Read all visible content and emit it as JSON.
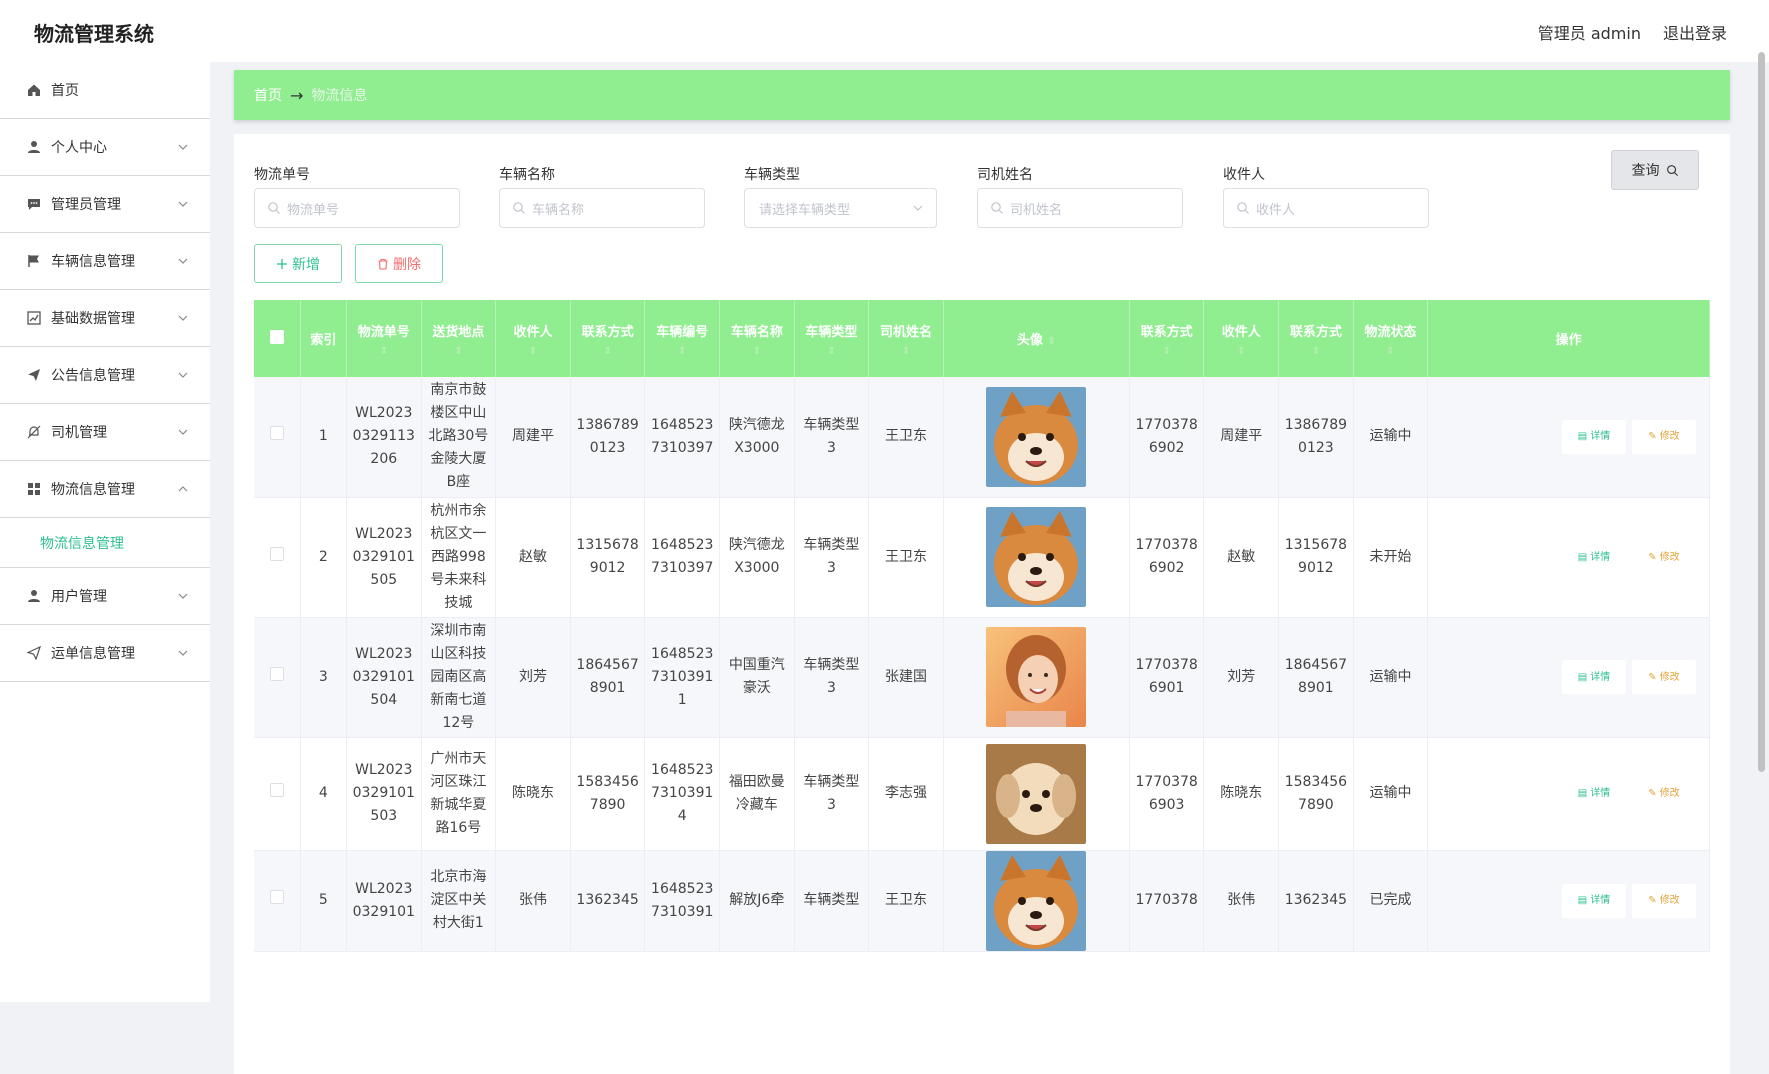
{
  "app": {
    "title": "物流管理系统",
    "user_label": "管理员 admin",
    "logout_label": "退出登录"
  },
  "sidebar": {
    "items": [
      {
        "label": "首页",
        "icon": "home-icon"
      },
      {
        "label": "个人中心",
        "icon": "user-icon"
      },
      {
        "label": "管理员管理",
        "icon": "chat-icon"
      },
      {
        "label": "车辆信息管理",
        "icon": "flag-icon"
      },
      {
        "label": "基础数据管理",
        "icon": "chart-icon"
      },
      {
        "label": "公告信息管理",
        "icon": "send-icon"
      },
      {
        "label": "司机管理",
        "icon": "bell-off-icon"
      },
      {
        "label": "物流信息管理",
        "icon": "grid-icon"
      },
      {
        "label": "用户管理",
        "icon": "user-icon"
      },
      {
        "label": "运单信息管理",
        "icon": "send-icon"
      }
    ],
    "submenu_label": "物流信息管理"
  },
  "breadcrumb": {
    "home": "首页",
    "arrow": "→",
    "current": "物流信息"
  },
  "filters": {
    "order_no": {
      "label": "物流单号",
      "placeholder": "物流单号"
    },
    "vehicle_name": {
      "label": "车辆名称",
      "placeholder": "车辆名称"
    },
    "vehicle_type": {
      "label": "车辆类型",
      "placeholder": "请选择车辆类型"
    },
    "driver_name": {
      "label": "司机姓名",
      "placeholder": "司机姓名"
    },
    "receiver": {
      "label": "收件人",
      "placeholder": "收件人"
    },
    "query_label": "查询"
  },
  "actions": {
    "add_label": "新增",
    "delete_label": "删除"
  },
  "table": {
    "headers": [
      "索引",
      "物流单号",
      "送货地点",
      "收件人",
      "联系方式",
      "车辆编号",
      "车辆名称",
      "车辆类型",
      "司机姓名",
      "头像",
      "联系方式",
      "收件人",
      "联系方式",
      "物流状态",
      "操作"
    ],
    "detail_label": "详情",
    "edit_label": "修改",
    "rows": [
      {
        "index": "1",
        "order_no": "WL2023\n0329113\n206",
        "address": "南京市鼓\n楼区中山\n北路30号\n金陵大厦\nB座",
        "receiver": "周建平",
        "phone": "1386789\n0123",
        "vehicle_no": "1648523\n7310397",
        "vehicle_name": "陕汽德龙\nX3000",
        "vehicle_type": "车辆类型\n3",
        "driver": "王卫东",
        "avatar": "shiba",
        "driver_phone": "1770378\n6902",
        "receiver2": "周建平",
        "phone2": "1386789\n0123",
        "status": "运输中"
      },
      {
        "index": "2",
        "order_no": "WL2023\n0329101\n505",
        "address": "杭州市余\n杭区文一\n西路998\n号未来科\n技城",
        "receiver": "赵敏",
        "phone": "1315678\n9012",
        "vehicle_no": "1648523\n7310397",
        "vehicle_name": "陕汽德龙\nX3000",
        "vehicle_type": "车辆类型\n3",
        "driver": "王卫东",
        "avatar": "shiba",
        "driver_phone": "1770378\n6902",
        "receiver2": "赵敏",
        "phone2": "1315678\n9012",
        "status": "未开始"
      },
      {
        "index": "3",
        "order_no": "WL2023\n0329101\n504",
        "address": "深圳市南\n山区科技\n园南区高\n新南七道\n12号",
        "receiver": "刘芳",
        "phone": "1864567\n8901",
        "vehicle_no": "1648523\n7310391\n1",
        "vehicle_name": "中国重汽\n豪沃",
        "vehicle_type": "车辆类型\n3",
        "driver": "张建国",
        "avatar": "girl",
        "driver_phone": "1770378\n6901",
        "receiver2": "刘芳",
        "phone2": "1864567\n8901",
        "status": "运输中"
      },
      {
        "index": "4",
        "order_no": "WL2023\n0329101\n503",
        "address": "广州市天\n河区珠江\n新城华夏\n路16号",
        "receiver": "陈晓东",
        "phone": "1583456\n7890",
        "vehicle_no": "1648523\n7310391\n4",
        "vehicle_name": "福田欧曼\n冷藏车",
        "vehicle_type": "车辆类型\n3",
        "driver": "李志强",
        "avatar": "puppy",
        "driver_phone": "1770378\n6903",
        "receiver2": "陈晓东",
        "phone2": "1583456\n7890",
        "status": "运输中"
      },
      {
        "index": "5",
        "order_no": "WL2023\n0329101",
        "address": "北京市海\n淀区中关\n村大街1",
        "receiver": "张伟",
        "phone": "1362345",
        "vehicle_no": "1648523\n7310391",
        "vehicle_name": "解放J6牵",
        "vehicle_type": "车辆类型",
        "driver": "王卫东",
        "avatar": "shiba",
        "driver_phone": "1770378",
        "receiver2": "张伟",
        "phone2": "1362345",
        "status": "已完成"
      }
    ]
  }
}
